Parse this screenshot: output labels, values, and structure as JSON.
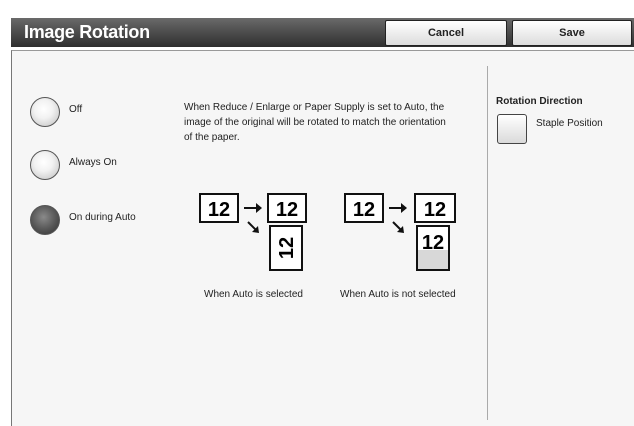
{
  "header": {
    "title": "Image Rotation",
    "cancel_label": "Cancel",
    "save_label": "Save"
  },
  "options": [
    {
      "label": "Off",
      "selected": false
    },
    {
      "label": "Always On",
      "selected": false
    },
    {
      "label": "On during Auto",
      "selected": true
    }
  ],
  "description": "When Reduce / Enlarge or Paper Supply is set to Auto, the image of the original will be rotated to match the orientation of the paper.",
  "diagram": {
    "sample_text": "12",
    "auto_caption": "When Auto is selected",
    "not_auto_caption": "When Auto is not selected"
  },
  "rotation_direction": {
    "title": "Rotation Direction",
    "option_label": "Staple Position"
  }
}
